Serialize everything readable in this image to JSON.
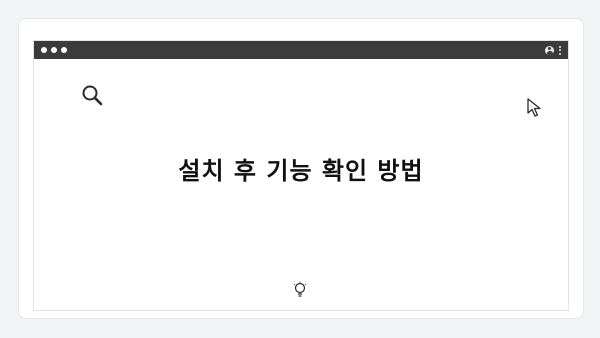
{
  "header": {
    "page_dots": 4
  },
  "window": {
    "title_bar": {
      "traffic_lights": 3,
      "profile_icon": "profile-icon",
      "menu_icon": "kebab-menu-icon"
    },
    "content": {
      "heading": "설치 후 기능 확인 방법",
      "icons": [
        "search-icon",
        "cursor-icon",
        "lightbulb-icon"
      ]
    }
  },
  "colors": {
    "title_bar": "#3b3b3b",
    "background": "#f1f3f5",
    "window": "#ffffff",
    "text": "#111111"
  }
}
